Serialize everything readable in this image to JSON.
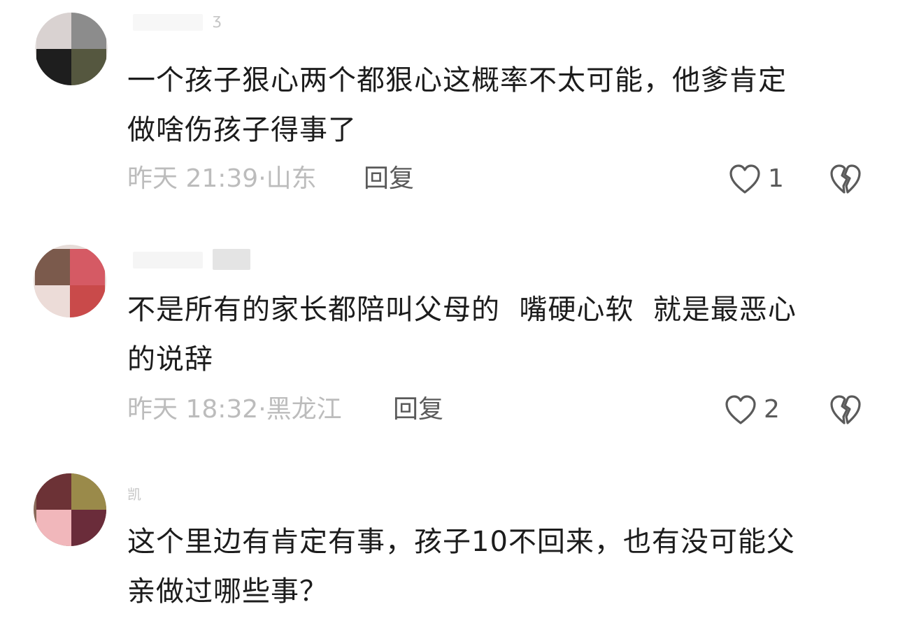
{
  "comments": [
    {
      "username": "ʒ",
      "text_line1": "一个孩子狠心两个都狠心这概率不太可能，他爹肯定",
      "text_line2": "做啥伤孩子得事了",
      "time": "昨天 21:39·",
      "location": "山东",
      "reply_label": "回复",
      "likes": "1",
      "avatar_colors": [
        "#d9d2d1",
        "#8c8c8c",
        "#1e1e1e",
        "#55573f"
      ]
    },
    {
      "username": "",
      "text_line1": "不是所有的家长都陪叫父母的  嘴硬心软  就是最恶心",
      "text_line2": "的说辞",
      "time": "昨天 18:32·",
      "location": "黑龙江",
      "reply_label": "回复",
      "likes": "2",
      "avatar_colors": [
        "#7b5a4c",
        "#d55a64",
        "#ecdcd8",
        "#c94a4a"
      ]
    },
    {
      "username": "凯",
      "text_line1": "这个里边有肯定有事，孩子10不回来，也有没可能父",
      "text_line2": "亲做过哪些事？",
      "avatar_colors": [
        "#6c3236",
        "#9a8a4a",
        "#f1b7bb",
        "#6a2c3a"
      ]
    }
  ],
  "icons": {
    "like": "heart-outline-icon",
    "dislike": "broken-heart-icon"
  },
  "colors": {
    "text": "#1c1c1c",
    "meta": "#bcbcbc",
    "action": "#5a5a5a"
  }
}
